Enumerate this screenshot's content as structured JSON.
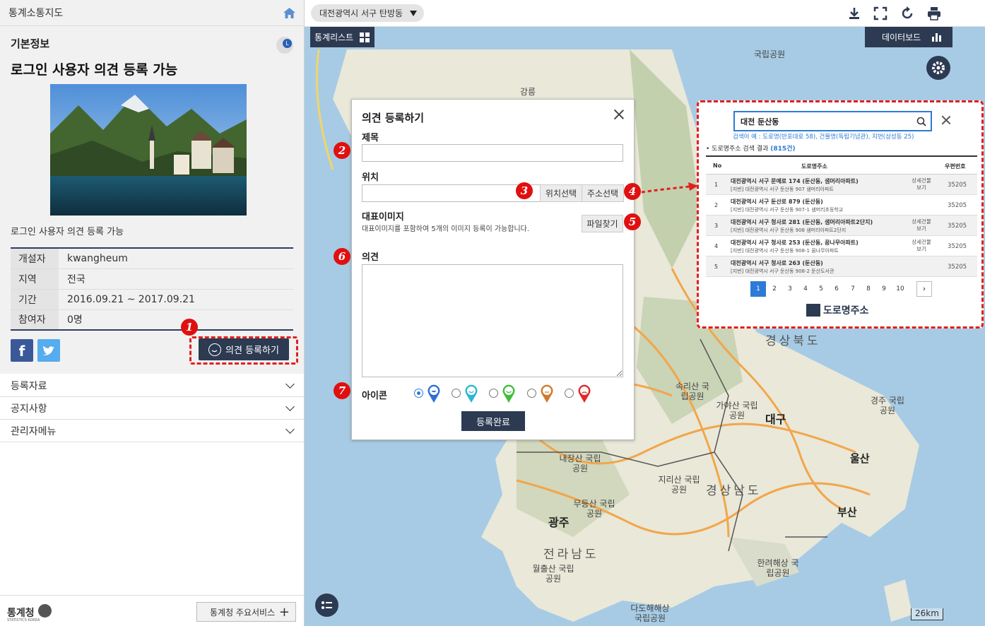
{
  "sidebar": {
    "app_title": "통계소통지도",
    "section_label": "기본정보",
    "lang_badge": "L",
    "main_title": "로그인 사용자 의견 등록 가능",
    "description": "로그인 사용자 의견 등록 가능",
    "info_rows": [
      {
        "key": "개설자",
        "value": "kwangheum"
      },
      {
        "key": "지역",
        "value": "전국"
      },
      {
        "key": "기간",
        "value": "2016.09.21 ~ 2017.09.21"
      },
      {
        "key": "참여자",
        "value": "0명"
      }
    ],
    "facebook_label": "f",
    "opinion_button": "의견 등록하기",
    "accordion": [
      "등록자료",
      "공지사항",
      "관리자메뉴"
    ],
    "footer_logo": "통계청",
    "footer_logo_sub": "STATISTICS KOREA",
    "footer_service": "통계청 주요서비스"
  },
  "map": {
    "location": "대전광역시 서구 탄방동",
    "stat_list_label": "통계리스트",
    "dashboard_label": "데이터보드",
    "scale": "26km"
  },
  "modal": {
    "title": "의견 등록하기",
    "subject_label": "제목",
    "subject_value": "",
    "location_label": "위치",
    "location_value": "",
    "pick_location_btn": "위치선택",
    "pick_address_btn": "주소선택",
    "image_label": "대표이미지",
    "image_hint": "대표이미지를 포함하여 5개의 이미지 등록이 가능합니다.",
    "file_btn": "파일찾기",
    "opinion_label": "의견",
    "icon_label": "아이콘",
    "icon_options": [
      {
        "name": "very-happy",
        "color": "#2f6fd6",
        "selected": true
      },
      {
        "name": "happy",
        "color": "#2bb6d6",
        "selected": false
      },
      {
        "name": "smile",
        "color": "#3fbf3a",
        "selected": false
      },
      {
        "name": "neutral",
        "color": "#d17a2a",
        "selected": false
      },
      {
        "name": "sad",
        "color": "#e02a2a",
        "selected": false
      }
    ],
    "submit_btn": "등록완료"
  },
  "callouts": [
    "1",
    "2",
    "3",
    "4",
    "5",
    "6",
    "7"
  ],
  "address_search": {
    "query": "대전 둔산동",
    "example": "검색어 예 : 도로명(반포대로 58), 건물명(독립기념관), 지번(삼성동 25)",
    "result_prefix": "• 도로명주소 검색 결과",
    "result_count": "(815건)",
    "headers": [
      "No",
      "도로명주소",
      "우편번호"
    ],
    "rows": [
      {
        "no": "1",
        "road": "대전광역시 서구 문예로 174 (둔산동, 샘머리아파트)",
        "jibun": "[지번] 대전광역시 서구 둔산동 907 샘머리아파트",
        "detail": "상세건물 보기",
        "zip": "35205"
      },
      {
        "no": "2",
        "road": "대전광역시 서구 둔산로 879 (둔산동)",
        "jibun": "[지번] 대전광역시 서구 둔산동 907-1 샘머리초등학교",
        "detail": "",
        "zip": "35205"
      },
      {
        "no": "3",
        "road": "대전광역시 서구 청사로 281 (둔산동, 샘머리아파트2단지)",
        "jibun": "[지번] 대전광역시 서구 둔산동 908 샘머리아파트2단지",
        "detail": "상세건물 보기",
        "zip": "35205"
      },
      {
        "no": "4",
        "road": "대전광역시 서구 청사로 253 (둔산동, 꿈나무아파트)",
        "jibun": "[지번] 대전광역시 서구 둔산동 908-1 꿈나무아파트",
        "detail": "상세건물 보기",
        "zip": "35205"
      },
      {
        "no": "5",
        "road": "대전광역시 서구 청사로 263 (둔산동)",
        "jibun": "[지번] 대전광역시 서구 둔산동 908-2 둔산도서관",
        "detail": "",
        "zip": "35205"
      }
    ],
    "pages": [
      "1",
      "2",
      "3",
      "4",
      "5",
      "6",
      "7",
      "8",
      "9",
      "10"
    ],
    "next": "›",
    "brand": "도로명주소"
  },
  "map_labels": [
    "국립공원",
    "경상북도",
    "대구",
    "가야산 국립공원",
    "경주 국립공원",
    "울산",
    "경상남도",
    "부산",
    "지리산 국립공원",
    "내장산 국립공원",
    "무등산 국립공원",
    "광주",
    "전라남도",
    "월출산 국립공원",
    "한려해상 국립공원",
    "다도해해상 국립공원",
    "속리산 국립공원",
    "강릉"
  ]
}
